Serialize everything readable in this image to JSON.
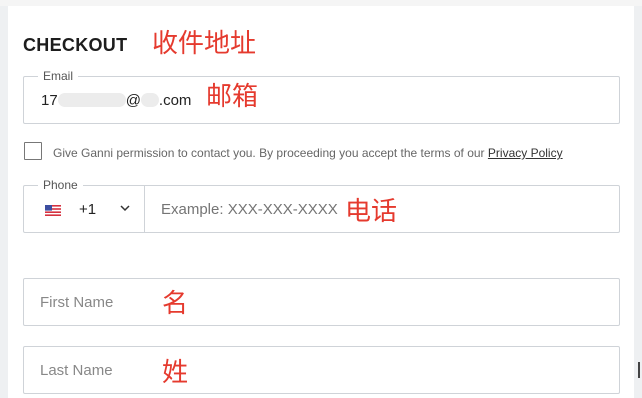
{
  "form": {
    "title": "CHECKOUT",
    "email": {
      "legend": "Email",
      "value_prefix": "17",
      "value_mid": "@",
      "value_suffix": ".com"
    },
    "consent": {
      "text": "Give Ganni permission to contact you. By proceeding you accept the terms of our",
      "link": "Privacy Policy"
    },
    "phone": {
      "legend": "Phone",
      "country_flag": "us-flag-icon",
      "dial_code": "+1",
      "placeholder": "Example: XXX-XXX-XXXX"
    },
    "first_name": {
      "placeholder": "First Name"
    },
    "last_name": {
      "placeholder": "Last Name"
    }
  },
  "annotations": {
    "address": "收件地址",
    "email": "邮箱",
    "phone": "电话",
    "first_name": "名",
    "last_name": "姓"
  },
  "colors": {
    "annotation": "#e53a2e",
    "border": "#cfd3d8",
    "background": "#eef0f2"
  }
}
